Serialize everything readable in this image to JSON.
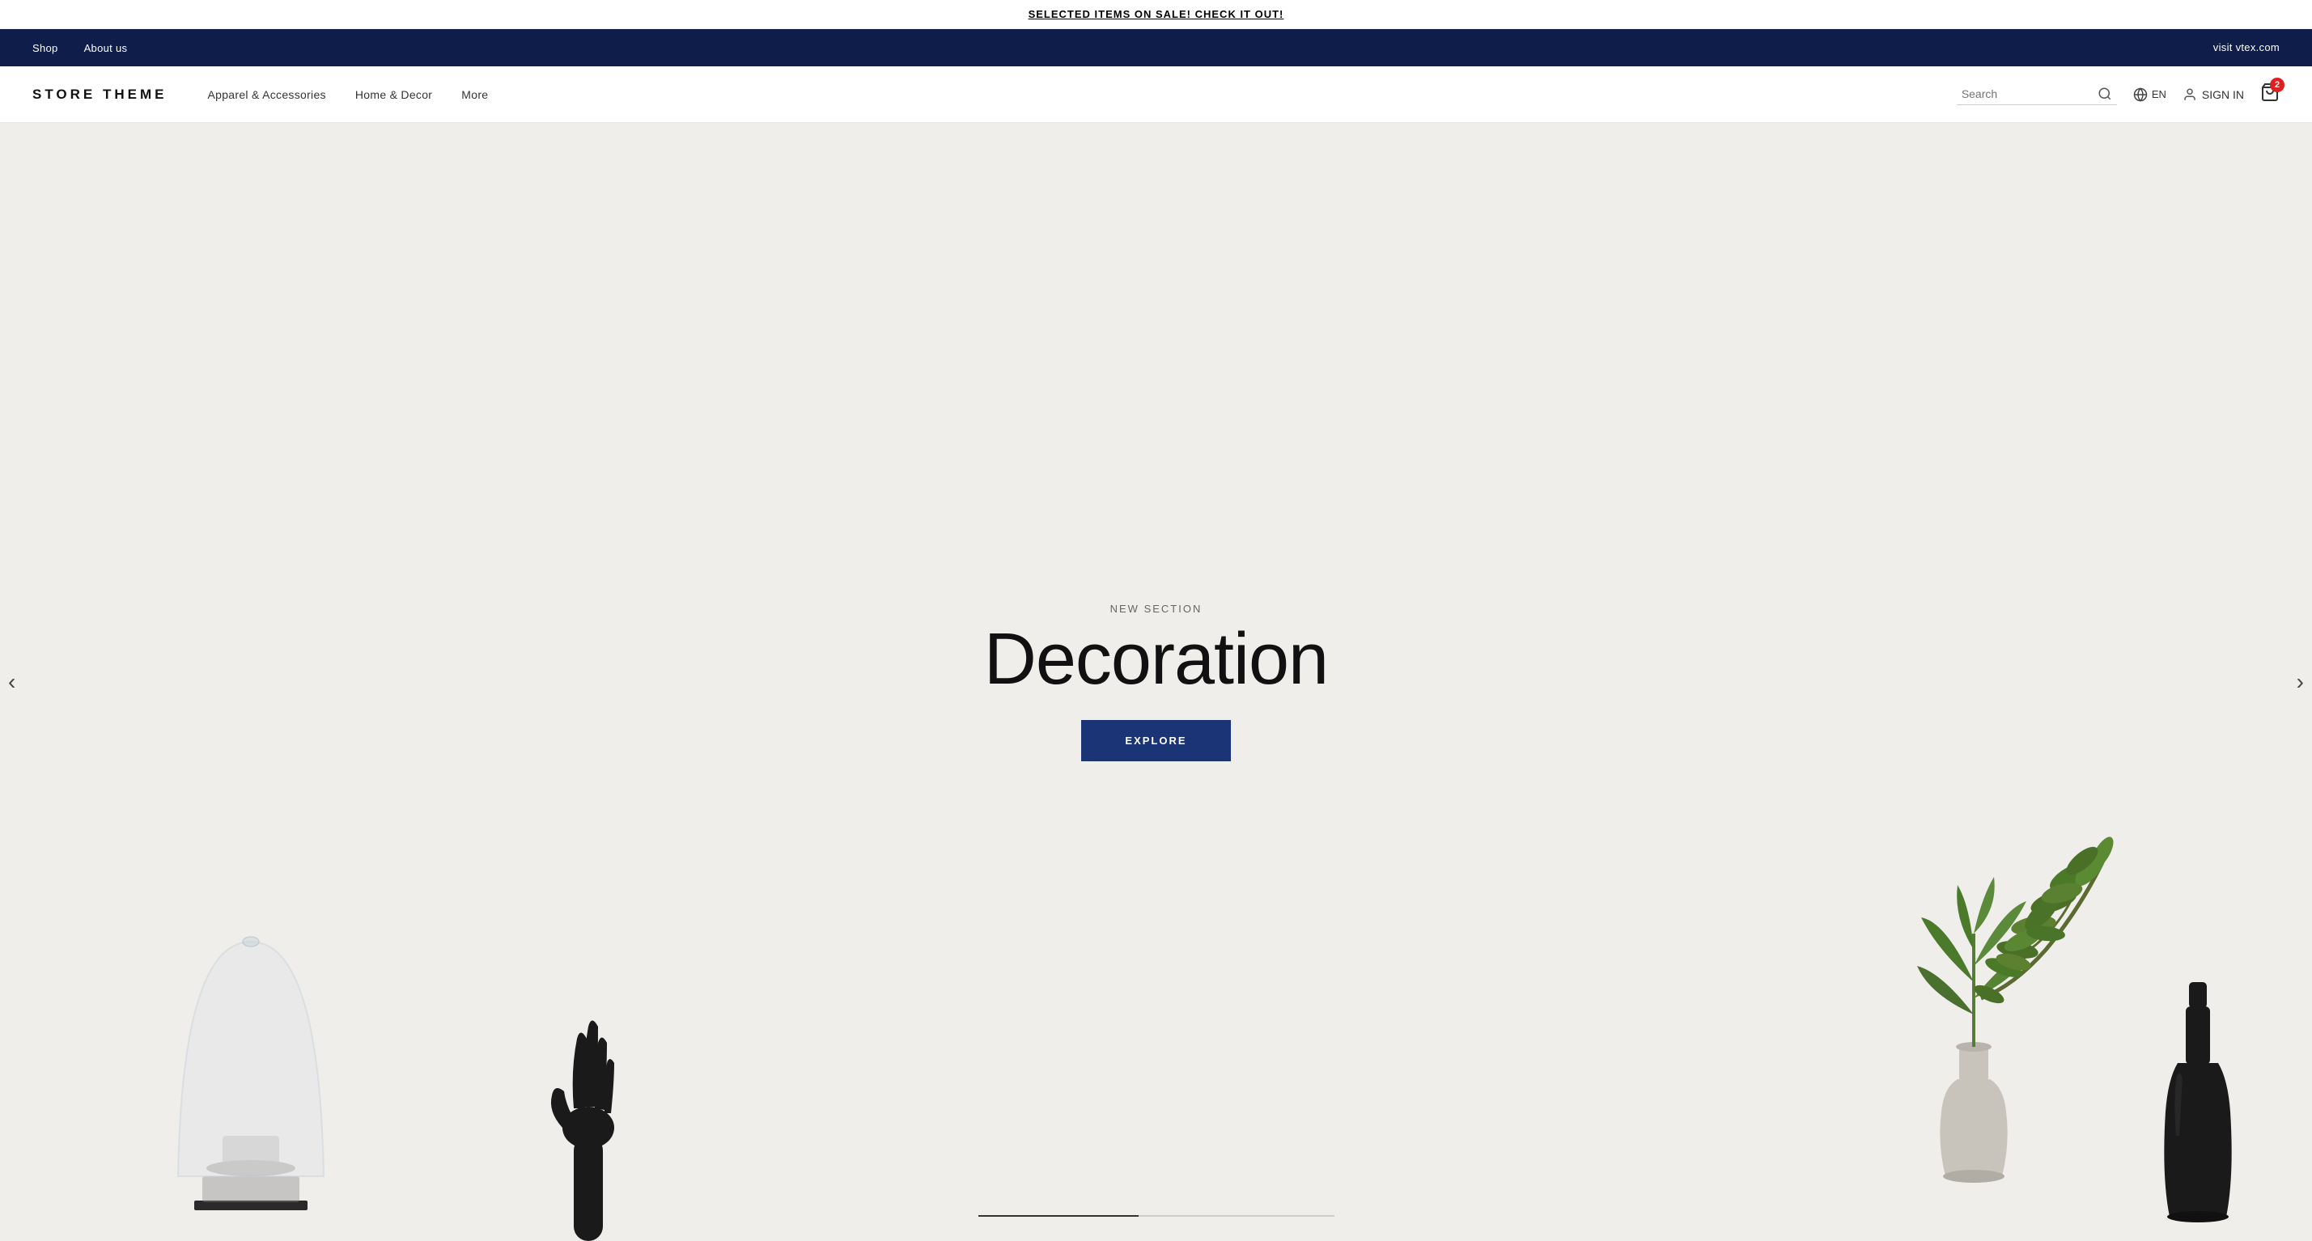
{
  "announcement": {
    "text": "SELECTED ITEMS ON SALE! CHECK IT OUT!"
  },
  "top_nav": {
    "left_links": [
      "Shop",
      "About us"
    ],
    "right_link": "visit vtex.com"
  },
  "header": {
    "logo": "STORE THEME",
    "nav_items": [
      "Apparel & Accessories",
      "Home & Decor",
      "More"
    ],
    "search_placeholder": "Search",
    "lang": "EN",
    "sign_in": "SIGN IN",
    "cart_count": "2"
  },
  "hero": {
    "subtitle": "NEW SECTION",
    "title": "Decoration",
    "cta_label": "EXPLORE",
    "prev_label": "‹",
    "next_label": "›"
  },
  "colors": {
    "top_nav_bg": "#0f1d4a",
    "cta_bg": "#1a3475",
    "cart_badge": "#e02020"
  }
}
